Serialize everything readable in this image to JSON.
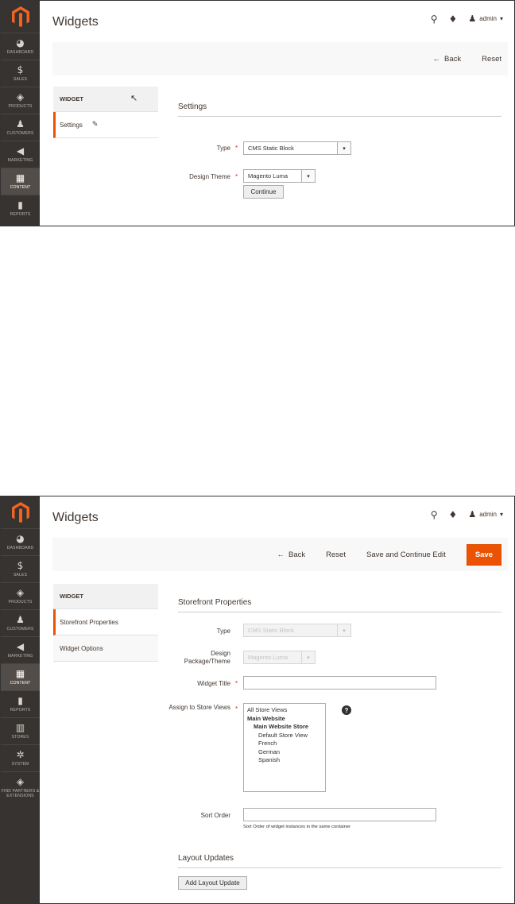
{
  "nav_top": {
    "items": [
      {
        "icon": "dashboard-icon",
        "glyph": "◕",
        "label": "Dashboard"
      },
      {
        "icon": "sales-icon",
        "glyph": "$",
        "label": "Sales"
      },
      {
        "icon": "products-icon",
        "glyph": "◈",
        "label": "Products"
      },
      {
        "icon": "customers-icon",
        "glyph": "♟",
        "label": "Customers"
      },
      {
        "icon": "marketing-icon",
        "glyph": "◀",
        "label": "Marketing"
      },
      {
        "icon": "content-icon",
        "glyph": "▦",
        "label": "Content"
      },
      {
        "icon": "reports-icon",
        "glyph": "▮",
        "label": "Reports"
      }
    ]
  },
  "nav_bottom": {
    "items": [
      {
        "icon": "dashboard-icon",
        "glyph": "◕",
        "label": "Dashboard"
      },
      {
        "icon": "sales-icon",
        "glyph": "$",
        "label": "Sales"
      },
      {
        "icon": "products-icon",
        "glyph": "◈",
        "label": "Products"
      },
      {
        "icon": "customers-icon",
        "glyph": "♟",
        "label": "Customers"
      },
      {
        "icon": "marketing-icon",
        "glyph": "◀",
        "label": "Marketing"
      },
      {
        "icon": "content-icon",
        "glyph": "▦",
        "label": "Content"
      },
      {
        "icon": "reports-icon",
        "glyph": "▮",
        "label": "Reports"
      },
      {
        "icon": "stores-icon",
        "glyph": "▥",
        "label": "Stores"
      },
      {
        "icon": "system-icon",
        "glyph": "✲",
        "label": "System"
      },
      {
        "icon": "partners-icon",
        "glyph": "◈",
        "label": "Find Partners & Extensions"
      }
    ]
  },
  "header": {
    "title": "Widgets",
    "user": "admin",
    "user_caret": "▾",
    "search_glyph": "⚲",
    "bell_glyph": "♦",
    "user_glyph": "♟"
  },
  "shot1": {
    "actions": {
      "back": "Back",
      "back_arrow": "←",
      "reset": "Reset"
    },
    "tabs": {
      "header": "Widget",
      "settings": "Settings",
      "pen_glyph": "✎"
    },
    "form": {
      "section": "Settings",
      "type_label": "Type",
      "type_value": "CMS Static Block",
      "theme_label": "Design Theme",
      "theme_value": "Magento Luma",
      "required_mark": "*",
      "arrow_glyph": "▾",
      "continue": "Continue"
    }
  },
  "shot2": {
    "actions": {
      "back": "Back",
      "back_arrow": "←",
      "reset": "Reset",
      "save_continue": "Save and Continue Edit",
      "save": "Save"
    },
    "tabs": {
      "header": "Widget",
      "storefront": "Storefront Properties",
      "options": "Widget Options"
    },
    "form": {
      "section": "Storefront Properties",
      "type_label": "Type",
      "type_value": "CMS Static Block",
      "package_label": "Design Package/Theme",
      "package_value": "Magento Luma",
      "title_label": "Widget Title",
      "title_value": "",
      "assign_label": "Assign to Store Views",
      "store_views": [
        "All Store Views",
        "Main Website",
        "Main Website Store",
        "Default Store View",
        "French",
        "German",
        "Spanish"
      ],
      "help_glyph": "?",
      "sort_label": "Sort Order",
      "sort_value": "",
      "sort_note": "Sort Order of widget instances in the same container",
      "layout_section": "Layout Updates",
      "add_layout": "Add Layout Update",
      "required_mark": "*",
      "arrow_glyph": "▾"
    }
  },
  "colors": {
    "accent": "#eb5202",
    "nav_bg": "#373330",
    "required": "#e22626"
  }
}
